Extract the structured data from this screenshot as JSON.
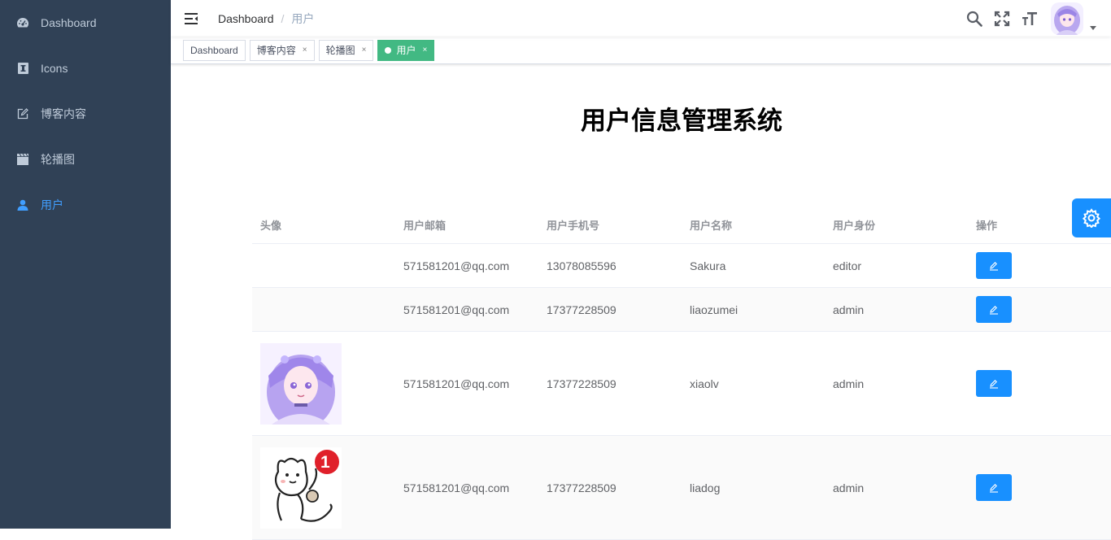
{
  "sidebar": {
    "items": [
      {
        "label": "Dashboard",
        "icon": "dashboard-icon"
      },
      {
        "label": "Icons",
        "icon": "icons-icon"
      },
      {
        "label": "博客内容",
        "icon": "edit-icon"
      },
      {
        "label": "轮播图",
        "icon": "clapper-icon"
      },
      {
        "label": "用户",
        "icon": "user-icon"
      }
    ]
  },
  "navbar": {
    "breadcrumb": {
      "home": "Dashboard",
      "separator": "/",
      "current": "用户"
    }
  },
  "tags": [
    {
      "label": "Dashboard"
    },
    {
      "label": "博客内容",
      "close": "×"
    },
    {
      "label": "轮播图",
      "close": "×"
    },
    {
      "label": "用户",
      "close": "×"
    }
  ],
  "page": {
    "title": "用户信息管理系统"
  },
  "table": {
    "headers": [
      "头像",
      "用户邮箱",
      "用户手机号",
      "用户名称",
      "用户身份",
      "操作"
    ],
    "rows": [
      {
        "email": "571581201@qq.com",
        "phone": "13078085596",
        "name": "Sakura",
        "role": "editor"
      },
      {
        "email": "571581201@qq.com",
        "phone": "17377228509",
        "name": "liaozumei",
        "role": "admin"
      },
      {
        "email": "571581201@qq.com",
        "phone": "17377228509",
        "name": "xiaolv",
        "role": "admin"
      },
      {
        "email": "571581201@qq.com",
        "phone": "17377228509",
        "name": "liadog",
        "role": "admin"
      }
    ],
    "cat_badge": "1"
  },
  "colors": {
    "sidebar_bg": "#304156",
    "sidebar_text": "#bfcbd9",
    "active_blue": "#409eff",
    "tag_active": "#42b983",
    "button_blue": "#1890ff"
  }
}
